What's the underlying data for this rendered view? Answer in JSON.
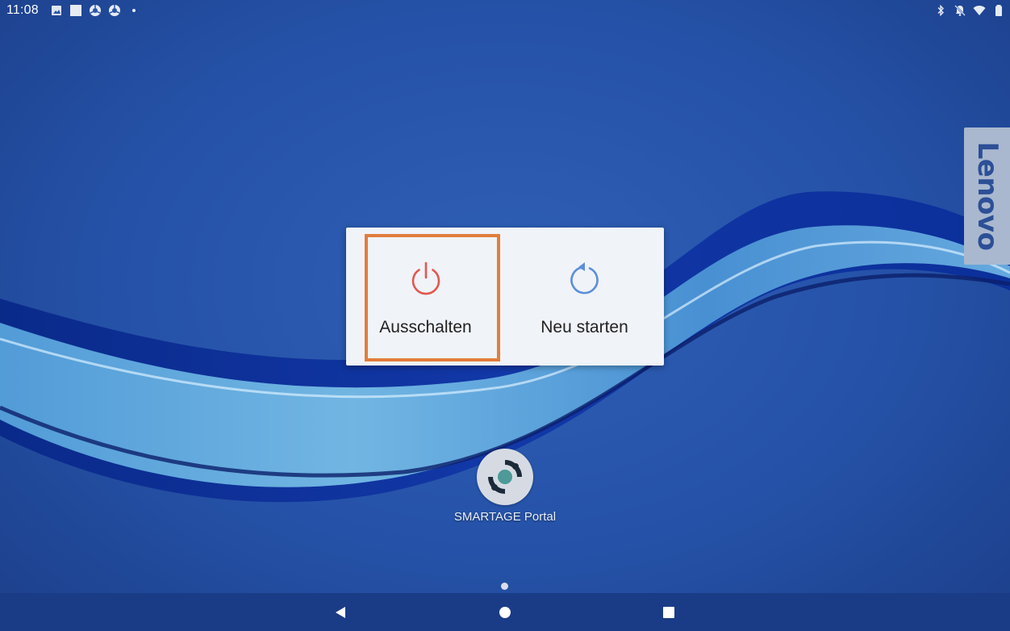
{
  "status_bar": {
    "time": "11:08",
    "left_icons": [
      "image-icon",
      "square-icon",
      "chrome-icon",
      "chrome-icon",
      "dot-icon"
    ],
    "right_icons": [
      "bluetooth-icon",
      "mute-icon",
      "wifi-icon",
      "battery-icon"
    ]
  },
  "brand": {
    "lenovo_label": "Lenovo"
  },
  "power_dialog": {
    "options": [
      {
        "label": "Ausschalten",
        "icon": "power-icon",
        "icon_color": "#e0584f"
      },
      {
        "label": "Neu starten",
        "icon": "restart-icon",
        "icon_color": "#5b8fdc"
      }
    ],
    "highlight_color": "#e27d3c"
  },
  "home": {
    "app": {
      "label": "SMARTAGE Portal",
      "icon": "smartage-logo-icon"
    },
    "page_count": 1,
    "current_page": 1
  },
  "nav_bar": {
    "buttons": [
      "back-icon",
      "home-icon",
      "recents-icon"
    ]
  }
}
